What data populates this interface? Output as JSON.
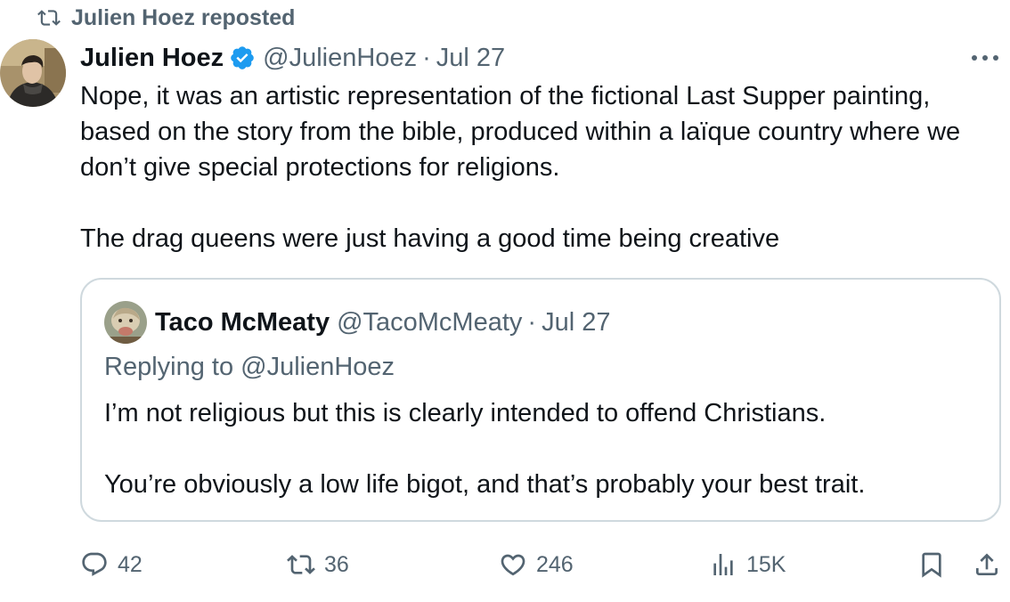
{
  "repost_banner": {
    "text": "Julien Hoez reposted",
    "icon": "repost-icon"
  },
  "post": {
    "author_name": "Julien Hoez",
    "verified_icon": "verified-badge-icon",
    "handle": "@JulienHoez",
    "separator": "·",
    "date": "Jul 27",
    "more_icon": "more-icon",
    "paragraphs": [
      "Nope, it was an artistic representation of the fictional Last Supper painting, based on the story from the bible, produced within a laïque country where we don’t give special protections for religions.",
      "The drag queens were just having a good time being creative"
    ]
  },
  "quoted": {
    "author_name": "Taco McMeaty",
    "handle": "@TacoMcMeaty",
    "separator": "·",
    "date": "Jul 27",
    "replying_to": "Replying to @JulienHoez",
    "paragraphs": [
      "I’m not religious but this is clearly intended to offend Christians.",
      "You’re obviously a low life bigot, and that’s probably your best trait."
    ]
  },
  "actions": {
    "replies": "42",
    "reposts": "36",
    "likes": "246",
    "views": "15K",
    "icons": [
      "reply-icon",
      "repost-icon",
      "like-icon",
      "views-icon",
      "bookmark-icon",
      "share-icon"
    ]
  },
  "colors": {
    "text": "#0f1419",
    "muted": "#536471",
    "verified": "#1d9bf0",
    "border": "#cfd9de"
  }
}
